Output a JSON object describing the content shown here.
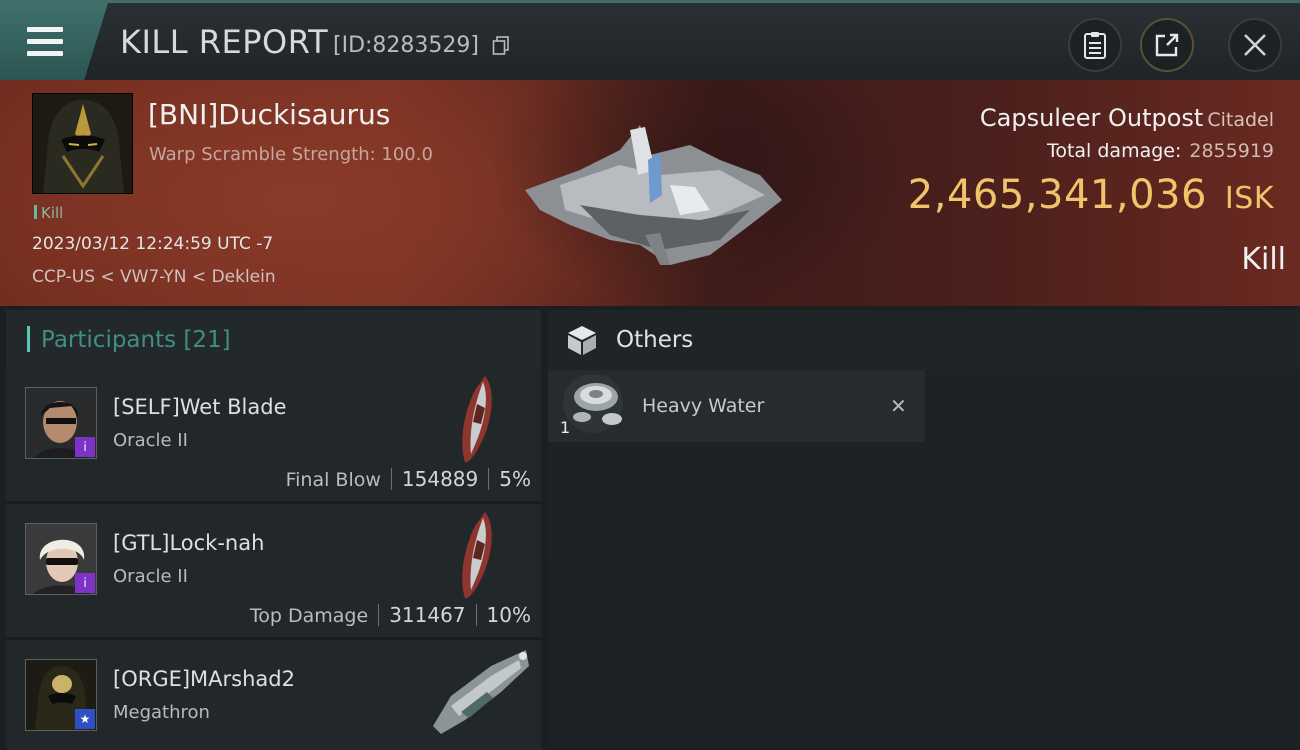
{
  "header": {
    "title": "KILL REPORT",
    "report_id": "[ID:8283529]",
    "icons": [
      "menu-icon",
      "copy-icon",
      "clipboard-icon",
      "share-icon",
      "close-icon"
    ]
  },
  "victim": {
    "name": "[BNI]Duckisaurus",
    "subtitle": "Warp Scramble Strength: 100.0",
    "tag": "Kill",
    "datetime": "2023/03/12 12:24:59 UTC -7",
    "location": "CCP-US < VW7-YN < Deklein",
    "ship_name": "Capsuleer Outpost",
    "ship_class": "Citadel",
    "total_damage_label": "Total damage:",
    "total_damage_value": "2855919",
    "isk_value": "2,465,341,036",
    "isk_unit": "ISK",
    "result": "Kill"
  },
  "participants": {
    "label": "Participants",
    "count": "[21]",
    "rows": [
      {
        "name": "[SELF]Wet Blade",
        "ship": "Oracle II",
        "stat_label": "Final Blow",
        "damage": "154889",
        "percent": "5%"
      },
      {
        "name": "[GTL]Lock-nah",
        "ship": "Oracle II",
        "stat_label": "Top Damage",
        "damage": "311467",
        "percent": "10%"
      },
      {
        "name": "[ORGE]MArshad2",
        "ship": "Megathron"
      }
    ]
  },
  "others": {
    "label": "Others",
    "items": [
      {
        "name": "Heavy Water",
        "qty": "1"
      }
    ]
  },
  "colors": {
    "accent_teal": "#5cc6b4",
    "isk_gold": "#f1c46b",
    "badge_purple": "#7d33c8",
    "badge_blue": "#2f4fc4"
  }
}
